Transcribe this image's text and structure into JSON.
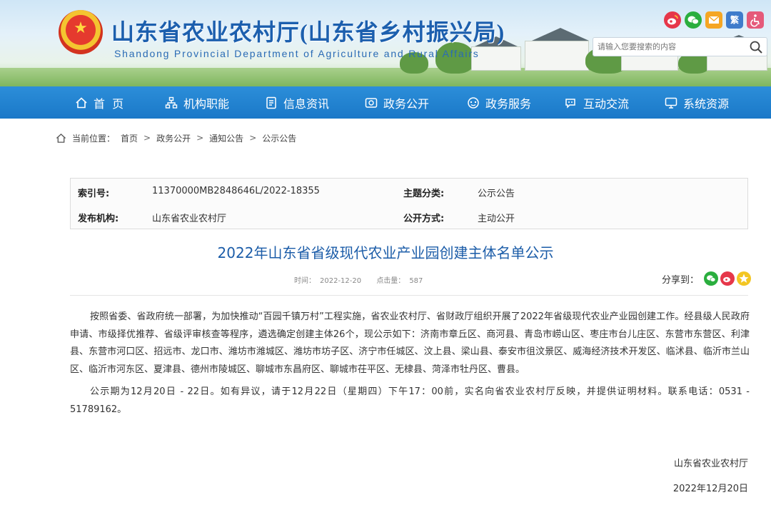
{
  "header": {
    "title": "山东省农业农村厅(山东省乡村振兴局)",
    "subtitle": "Shandong Provincial Department of Agriculture and Rural Affairs",
    "emblem_icon": "national-emblem-icon",
    "tools": {
      "weibo_icon": "weibo-icon",
      "wechat_icon": "wechat-icon",
      "mail_icon": "mail-icon",
      "traditional_label": "繁",
      "accessibility_icon": "accessibility-icon"
    },
    "search": {
      "placeholder": "请输入您要搜索的内容",
      "icon": "search-icon"
    }
  },
  "nav": {
    "items": [
      {
        "label": "首  页",
        "icon": "home-icon"
      },
      {
        "label": "机构职能",
        "icon": "org-icon"
      },
      {
        "label": "信息资讯",
        "icon": "document-icon"
      },
      {
        "label": "政务公开",
        "icon": "open-icon"
      },
      {
        "label": "政务服务",
        "icon": "service-icon"
      },
      {
        "label": "互动交流",
        "icon": "chat-icon"
      },
      {
        "label": "系统资源",
        "icon": "screen-icon"
      }
    ]
  },
  "breadcrumb": {
    "prefix": "当前位置：",
    "items": [
      "首页",
      "政务公开",
      "通知公告",
      "公示公告"
    ],
    "separator": ">"
  },
  "meta": {
    "index_label": "索引号:",
    "index_value": "11370000MB2848646L/2022-18355",
    "topic_label": "主题分类:",
    "topic_value": "公示公告",
    "publisher_label": "发布机构:",
    "publisher_value": "山东省农业农村厅",
    "disclosure_label": "公开方式:",
    "disclosure_value": "主动公开"
  },
  "article": {
    "title": "2022年山东省省级现代农业产业园创建主体名单公示",
    "time_label": "时间：",
    "time_value": "2022-12-20",
    "clicks_label": "点击量：",
    "clicks_value": "587",
    "share_label": "分享到：",
    "paragraph1": "按照省委、省政府统一部署，为加快推动“百园千镇万村”工程实施，省农业农村厅、省财政厅组织开展了2022年省级现代农业产业园创建工作。经县级人民政府申请、市级择优推荐、省级评审核查等程序，遴选确定创建主体26个，现公示如下：济南市章丘区、商河县、青岛市崂山区、枣庄市台儿庄区、东营市东营区、利津县、东营市河口区、招远市、龙口市、潍坊市潍城区、潍坊市坊子区、济宁市任城区、汶上县、梁山县、泰安市徂汶景区、威海经济技术开发区、临沭县、临沂市兰山区、临沂市河东区、夏津县、德州市陵城区、聊城市东昌府区、聊城市茌平区、无棣县、菏泽市牡丹区、曹县。",
    "paragraph2": "公示期为12月20日 - 22日。如有异议，请于12月22日（星期四）下午17：00前，实名向省农业农村厅反映，并提供证明材料。联系电话：0531 - 51789162。",
    "signature": "山东省农业农村厅",
    "sign_date": "2022年12月20日"
  },
  "colors": {
    "nav_bg": "#1a78c8",
    "title_blue": "#1b5ca8",
    "header_title": "#1c5fae"
  }
}
